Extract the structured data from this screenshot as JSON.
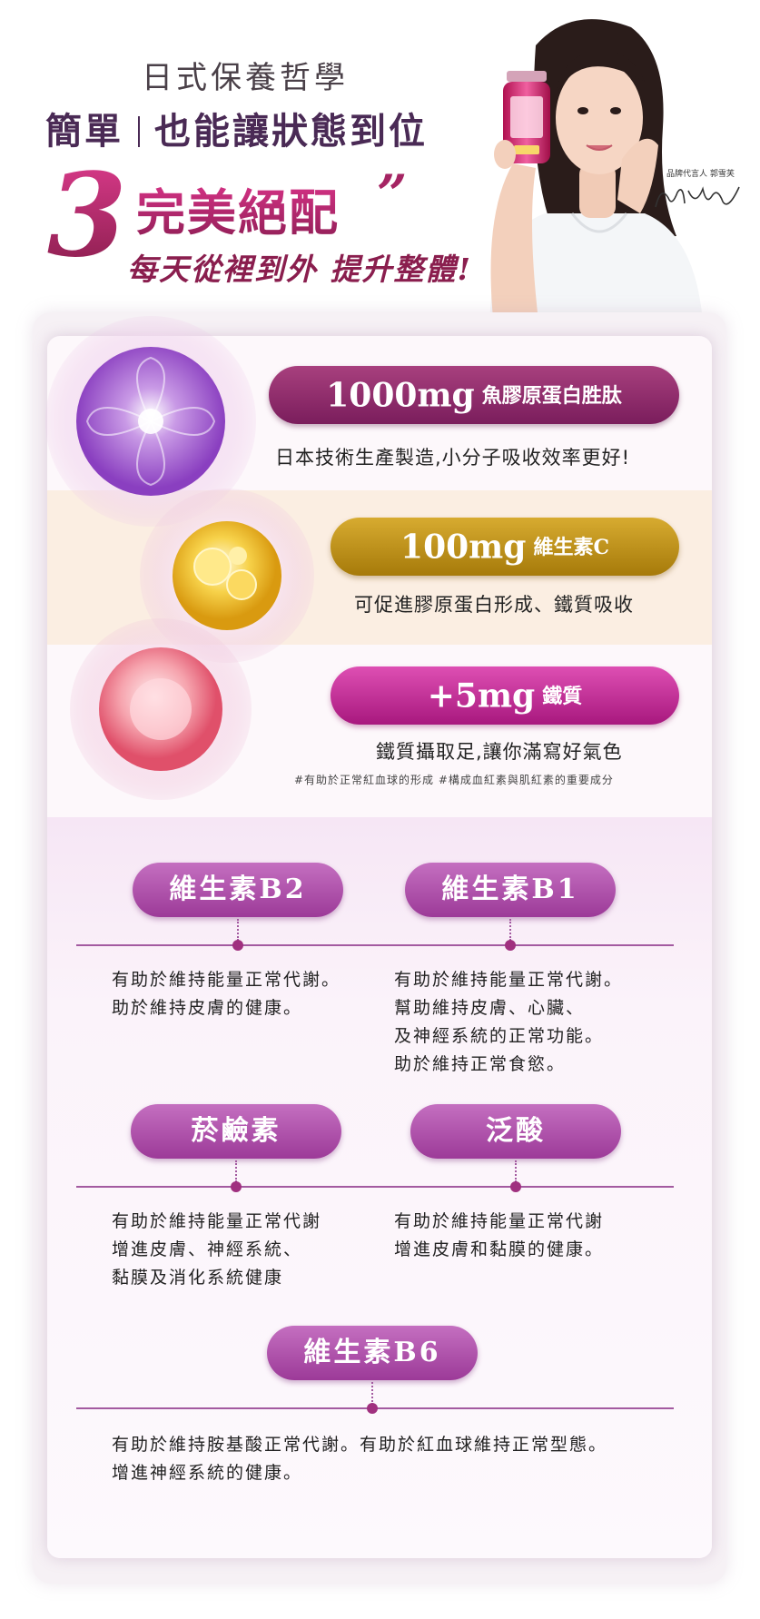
{
  "header": {
    "line1": "日式保養哲學",
    "line2_left": "簡單",
    "line2_right": "也能讓狀態到位",
    "big_number": "3",
    "line3": "完美絕配",
    "quote_mark": "”",
    "line4": "每天從裡到外 提升整體!"
  },
  "spokesperson": {
    "label": "品牌代言人 郭雪芙"
  },
  "ingredients": [
    {
      "amount": "1000mg",
      "name": "魚膠原蛋白胜肽",
      "desc": "日本技術生產製造,小分子吸收效率更好!"
    },
    {
      "amount": "100mg",
      "name": "維生素C",
      "desc": "可促進膠原蛋白形成、鐵質吸收"
    },
    {
      "amount": "+5mg",
      "name": "鐵質",
      "desc": "鐵質攝取足,讓你滿寫好氣色",
      "tags": "#有助於正常紅血球的形成  #構成血紅素與肌紅素的重要成分"
    }
  ],
  "vitamins": [
    {
      "name": "維生素B2",
      "lines": [
        "有助於維持能量正常代謝。",
        "助於維持皮膚的健康。"
      ]
    },
    {
      "name": "維生素B1",
      "lines": [
        "有助於維持能量正常代謝。",
        "幫助維持皮膚、心臟、",
        "及神經系統的正常功能。",
        "助於維持正常食慾。"
      ]
    },
    {
      "name": "菸鹼素",
      "lines": [
        "有助於維持能量正常代謝",
        "增進皮膚、神經系統、",
        "黏膜及消化系統健康"
      ]
    },
    {
      "name": "泛酸",
      "lines": [
        "有助於維持能量正常代謝",
        "增進皮膚和黏膜的健康。"
      ]
    },
    {
      "name": "維生素B6",
      "lines": [
        "有助於維持胺基酸正常代謝。有助於紅血球維持正常型態。",
        "增進神經系統的健康。"
      ]
    }
  ],
  "colors": {
    "purple_pill": "#8e2a6e",
    "gold_pill": "#c79a1a",
    "magenta_pill": "#c8289c",
    "vitamin_pill": "#b057ad"
  }
}
